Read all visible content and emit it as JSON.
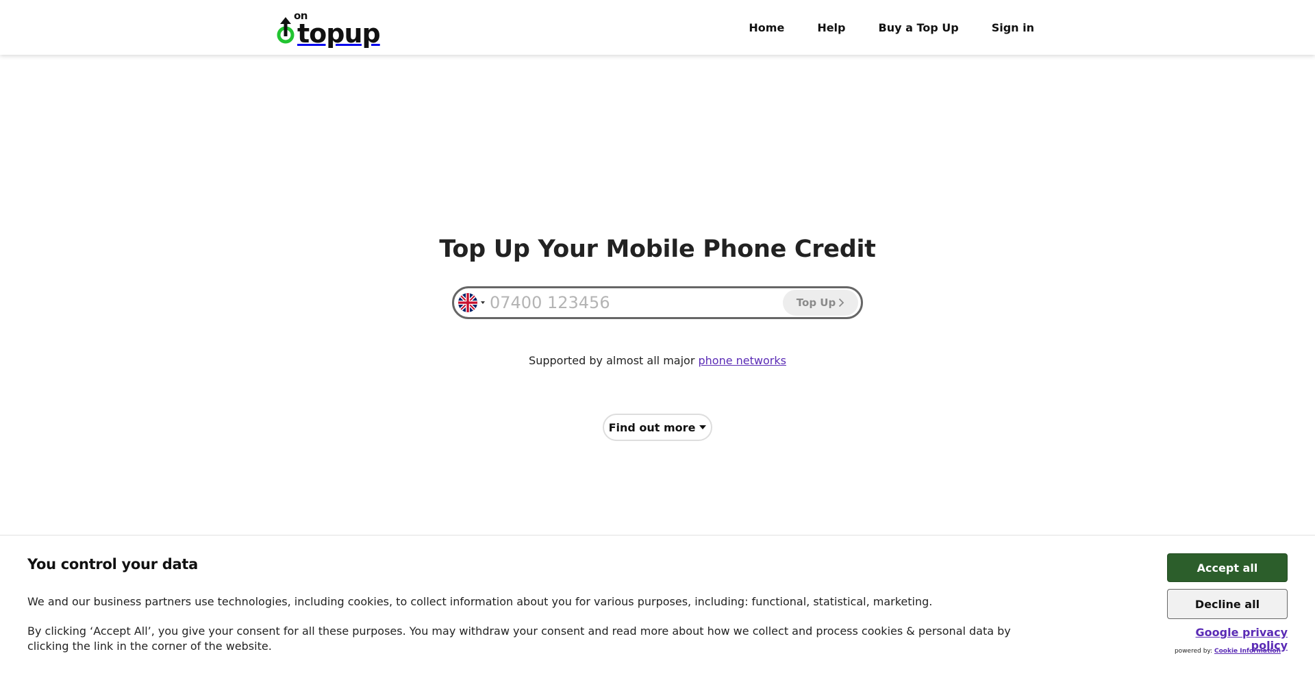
{
  "brand": {
    "logo_text": "topup",
    "logo_small": "on",
    "accent": "#22c431"
  },
  "nav": {
    "items": [
      {
        "label": "Home"
      },
      {
        "label": "Help"
      },
      {
        "label": "Buy a Top Up"
      },
      {
        "label": "Sign in"
      }
    ]
  },
  "hero": {
    "title": "Top Up Your Mobile Phone Credit",
    "phone_placeholder": "07400 123456",
    "phone_value": "",
    "country_icon": "uk-flag-icon",
    "topup_label": "Top Up",
    "supported_text": "Supported by almost all major ",
    "supported_link": "phone networks",
    "find_more_label": "Find out more"
  },
  "cookie": {
    "title": "You control your data",
    "paragraph1": "We and our business partners use technologies, including cookies, to collect information about you for various purposes, including: functional, statistical, marketing.",
    "paragraph2": "By clicking ‘Accept All’, you give your consent for all these purposes. You may withdraw your consent and read more about how we collect and process cookies & personal data by clicking the link in the corner of the website.",
    "accept_label": "Accept all",
    "decline_label": "Decline all",
    "privacy_label": "Google privacy policy",
    "powered_text": "powered by: ",
    "powered_link": "Cookie Information",
    "accept_color": "#2c5e2b"
  }
}
